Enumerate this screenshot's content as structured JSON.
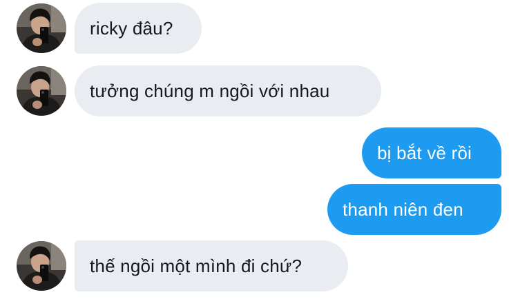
{
  "messages": [
    {
      "sender": "other",
      "text": "ricky đâu?"
    },
    {
      "sender": "other",
      "text": "tưởng chúng m ngồi với nhau"
    },
    {
      "sender": "me",
      "text": "bị bắt về rồi"
    },
    {
      "sender": "me",
      "text": "thanh niên đen"
    },
    {
      "sender": "other",
      "text": "thế ngồi một mình đi chứ?"
    }
  ],
  "colors": {
    "incoming_bubble": "#e9ecf0",
    "incoming_text": "#141823",
    "outgoing_bubble": "#1d9bf0",
    "outgoing_text": "#ffffff"
  },
  "icons": {
    "avatar": "profile-photo-avatar"
  }
}
